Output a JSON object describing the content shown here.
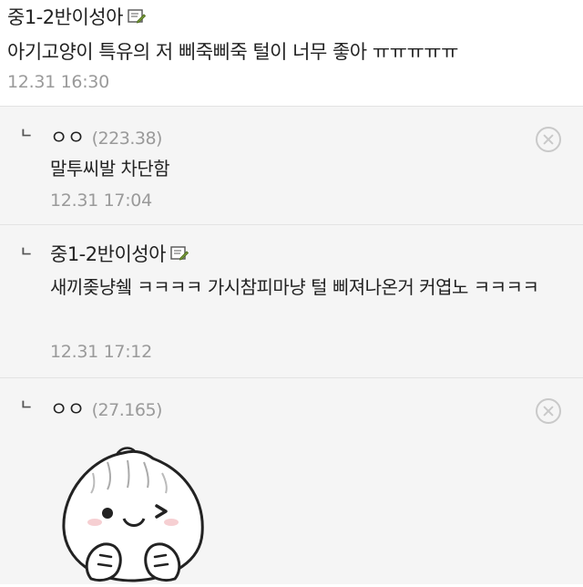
{
  "post": {
    "nickname": "중1-2반이성아",
    "body": "아기고양이 특유의 저 삐죽삐죽 털이 너무 좋아 ㅠㅠㅠㅠㅠ",
    "time": "12.31 16:30"
  },
  "comments": [
    {
      "reply_mark": "ㄴ",
      "nickname": "ㅇㅇ",
      "ip": "(223.38)",
      "text": "말투씨발 차단함",
      "time": "12.31 17:04"
    },
    {
      "reply_mark": "ㄴ",
      "nickname": "중1-2반이성아",
      "text": "새끼좆냥쉨 ㅋㅋㅋㅋ 가시참피마냥 털 삐져나온거 커엽노 ㅋㅋㅋㅋ",
      "time": "12.31 17:12"
    },
    {
      "reply_mark": "ㄴ",
      "nickname": "ㅇㅇ",
      "ip": "(27.165)",
      "sticker": "dumpling-wink-sticker"
    }
  ],
  "icons": {
    "memo": "memo-icon",
    "delete": "close-circle-icon"
  },
  "colors": {
    "comment_bg": "#f5f5f5",
    "meta_gray": "#9a9a9a"
  }
}
